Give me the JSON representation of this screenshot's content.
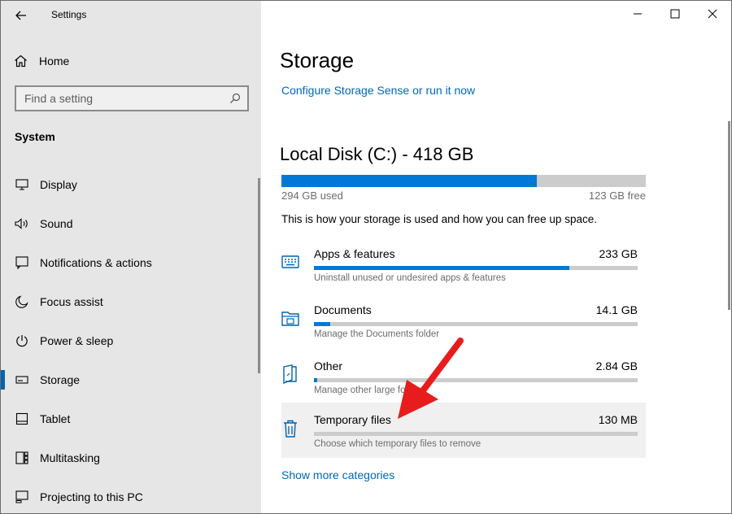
{
  "window": {
    "title": "Settings",
    "controls": [
      "minimize-icon",
      "maximize-icon",
      "close-icon"
    ]
  },
  "sidebar": {
    "home_label": "Home",
    "search": {
      "placeholder": "Find a setting",
      "value": ""
    },
    "section_title": "System",
    "active_item": "Storage",
    "items": [
      {
        "label": "Display",
        "icon": "monitor-icon"
      },
      {
        "label": "Sound",
        "icon": "speaker-icon"
      },
      {
        "label": "Notifications & actions",
        "icon": "notification-icon"
      },
      {
        "label": "Focus assist",
        "icon": "moon-icon"
      },
      {
        "label": "Power & sleep",
        "icon": "power-icon"
      },
      {
        "label": "Storage",
        "icon": "drive-icon"
      },
      {
        "label": "Tablet",
        "icon": "tablet-icon"
      },
      {
        "label": "Multitasking",
        "icon": "multitasking-icon"
      },
      {
        "label": "Projecting to this PC",
        "icon": "projecting-icon"
      }
    ]
  },
  "main": {
    "title": "Storage",
    "configure_link": "Configure Storage Sense or run it now",
    "disk": {
      "title": "Local Disk (C:) - 418 GB",
      "used_label": "294 GB used",
      "free_label": "123 GB free",
      "used_fraction": 0.7
    },
    "description": "This is how your storage is used and how you can free up space.",
    "categories": [
      {
        "name": "Apps & features",
        "size": "233 GB",
        "subtitle": "Uninstall unused or undesired apps & features",
        "fraction": 0.79,
        "icon": "apps-icon"
      },
      {
        "name": "Documents",
        "size": "14.1 GB",
        "subtitle": "Manage the Documents folder",
        "fraction": 0.05,
        "icon": "folder-icon"
      },
      {
        "name": "Other",
        "size": "2.84 GB",
        "subtitle": "Manage other large folders",
        "fraction": 0.01,
        "icon": "other-files-icon"
      },
      {
        "name": "Temporary files",
        "size": "130 MB",
        "subtitle": "Choose which temporary files to remove",
        "fraction": 0.0,
        "icon": "trash-icon",
        "highlighted": true
      }
    ],
    "more_link": "Show more categories"
  },
  "annotation": {
    "arrow_color": "#e81c1c"
  },
  "colors": {
    "accent": "#0078d7",
    "link": "#0067b8",
    "sidebar_bg": "#e6e6e6"
  }
}
